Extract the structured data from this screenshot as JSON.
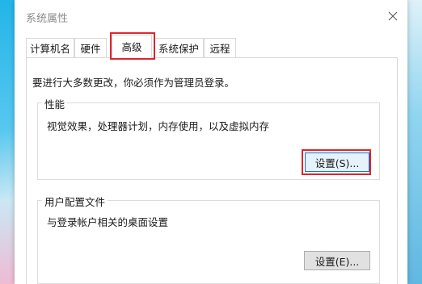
{
  "window": {
    "title": "系统属性"
  },
  "tabs": [
    {
      "label": "计算机名"
    },
    {
      "label": "硬件"
    },
    {
      "label": "高级",
      "active": true
    },
    {
      "label": "系统保护"
    },
    {
      "label": "远程"
    }
  ],
  "advanced": {
    "intro": "要进行大多数更改，你必须作为管理员登录。",
    "performance": {
      "title": "性能",
      "description": "视觉效果，处理器计划，内存使用，以及虚拟内存",
      "settings_label": "设置(S)..."
    },
    "user_profiles": {
      "title": "用户配置文件",
      "description": "与登录帐户相关的桌面设置",
      "settings_label": "设置(E)..."
    }
  },
  "colors": {
    "highlight": "#e0242d",
    "accent": "#0078d7"
  },
  "icons": {
    "close": "close-icon"
  }
}
